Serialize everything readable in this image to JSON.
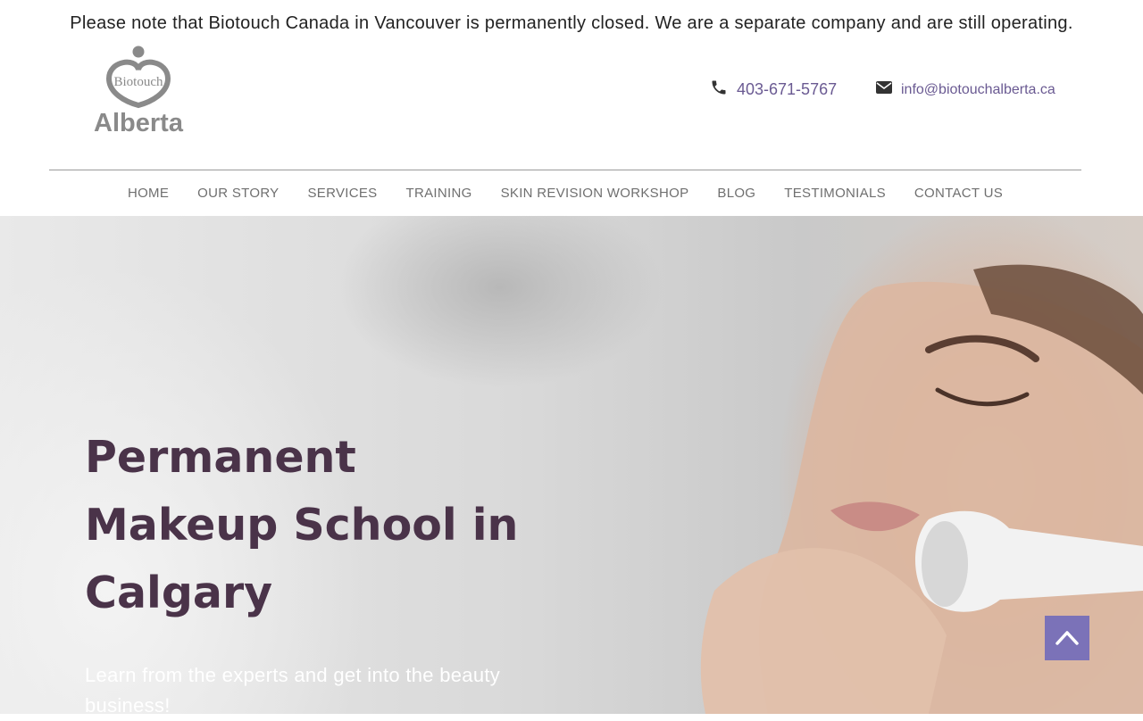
{
  "notice": {
    "text": "Please note that Biotouch Canada in Vancouver is permanently closed. We are a separate company and are still operating."
  },
  "logo": {
    "top_text": "Biotouch",
    "bottom_text": "Alberta"
  },
  "contact": {
    "phone": "403-671-5767",
    "phone_icon": "phone-icon",
    "email": "info@biotouchalberta.ca",
    "email_icon": "envelope-icon"
  },
  "nav": {
    "items": [
      {
        "label": "HOME"
      },
      {
        "label": "OUR STORY"
      },
      {
        "label": "SERVICES"
      },
      {
        "label": "TRAINING"
      },
      {
        "label": "SKIN REVISION WORKSHOP"
      },
      {
        "label": "BLOG"
      },
      {
        "label": "TESTIMONIALS"
      },
      {
        "label": "CONTACT US"
      }
    ]
  },
  "hero": {
    "title": "Permanent Makeup School in Calgary",
    "subtitle": "Learn from the experts and get into the beauty business!"
  },
  "scroll_top": {
    "icon": "chevron-up-icon"
  },
  "colors": {
    "accent": "#7b72b8",
    "link": "#6a5a92",
    "title": "#4a3349",
    "nav_text": "#6f6f6f"
  }
}
